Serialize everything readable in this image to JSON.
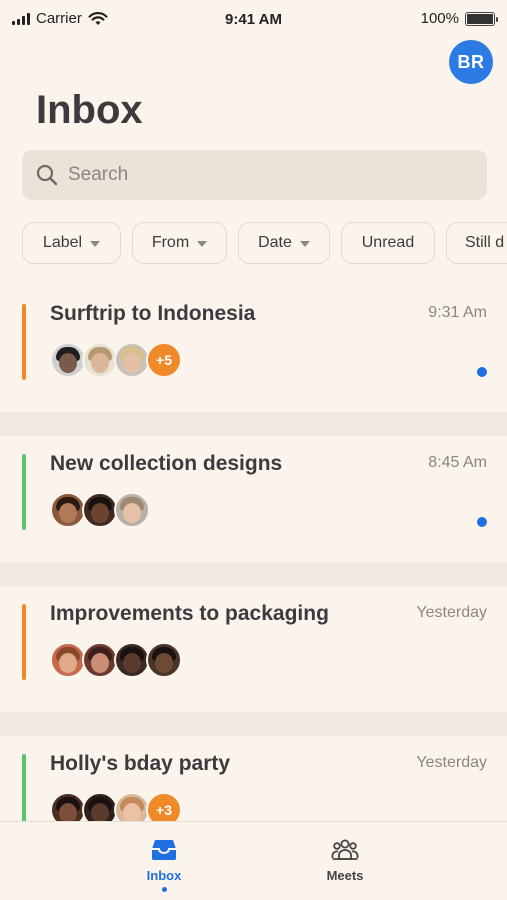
{
  "status_bar": {
    "carrier": "Carrier",
    "time": "9:41 AM",
    "battery": "100%",
    "battery_level": 1.0
  },
  "user": {
    "initials": "BR",
    "color": "#2c7be5"
  },
  "header": {
    "title": "Inbox"
  },
  "search": {
    "placeholder": "Search"
  },
  "filters": [
    {
      "label": "Label",
      "has_dropdown": true
    },
    {
      "label": "From",
      "has_dropdown": true
    },
    {
      "label": "Date",
      "has_dropdown": true
    },
    {
      "label": "Unread",
      "has_dropdown": false
    },
    {
      "label": "Still d",
      "has_dropdown": false
    }
  ],
  "threads": [
    {
      "title": "Surftrip to Indonesia",
      "time": "9:31 Am",
      "accent": "#f08a28",
      "unread": true,
      "more": "+5",
      "avatars": [
        {
          "skin": "#7a5a48",
          "hair": "#1e1e1e",
          "bg": "#cfcfcf"
        },
        {
          "skin": "#d9b89a",
          "hair": "#b99a70",
          "bg": "#e8e2d4"
        },
        {
          "skin": "#e3c0a3",
          "hair": "#d8c08c",
          "bg": "#c9c2b8"
        }
      ]
    },
    {
      "title": "New collection designs",
      "time": "8:45 Am",
      "accent": "#5cc46c",
      "unread": true,
      "more": "",
      "avatars": [
        {
          "skin": "#b07a58",
          "hair": "#2a1a12",
          "bg": "#8b5a3c"
        },
        {
          "skin": "#6b4430",
          "hair": "#1a1210",
          "bg": "#3e2a20"
        },
        {
          "skin": "#e3c2a8",
          "hair": "#a08870",
          "bg": "#b8b0a6"
        }
      ]
    },
    {
      "title": "Improvements to packaging",
      "time": "Yesterday",
      "accent": "#f08a28",
      "unread": false,
      "more": "",
      "avatars": [
        {
          "skin": "#e0a98a",
          "hair": "#8a4a2a",
          "bg": "#c86a4a"
        },
        {
          "skin": "#c98c74",
          "hair": "#3a2018",
          "bg": "#6a3a30"
        },
        {
          "skin": "#5a3a2a",
          "hair": "#1a1210",
          "bg": "#3a2a24"
        },
        {
          "skin": "#6e4a36",
          "hair": "#1a1210",
          "bg": "#4a3428"
        }
      ]
    },
    {
      "title": "Holly's bday party",
      "time": "Yesterday",
      "accent": "#5cc46c",
      "unread": false,
      "more": "+3",
      "avatars": [
        {
          "skin": "#7a4e38",
          "hair": "#1a1210",
          "bg": "#4a2e22"
        },
        {
          "skin": "#5a3a2a",
          "hair": "#1a1210",
          "bg": "#2e201a"
        },
        {
          "skin": "#ecc2a6",
          "hair": "#c48a5a",
          "bg": "#d8b89a"
        }
      ]
    }
  ],
  "tabs": [
    {
      "label": "Inbox",
      "active": true
    },
    {
      "label": "Meets",
      "active": false
    }
  ]
}
